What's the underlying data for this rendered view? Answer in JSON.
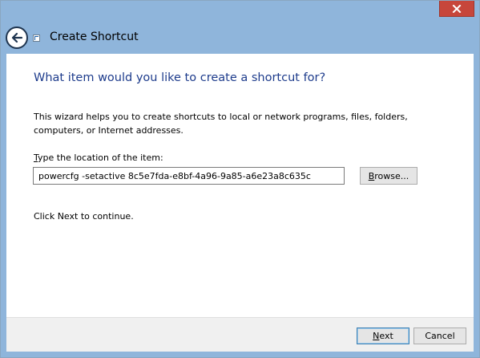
{
  "window": {
    "title": "Create Shortcut"
  },
  "content": {
    "heading": "What item would you like to create a shortcut for?",
    "description": "This wizard helps you to create shortcuts to local or network programs, files, folders, computers, or Internet addresses.",
    "field_label_prefix": "T",
    "field_label_rest": "ype the location of the item:",
    "location_value": "powercfg -setactive 8c5e7fda-e8bf-4a96-9a85-a6e23a8c635c",
    "browse_label_prefix": "B",
    "browse_label_rest": "rowse...",
    "continue_text": "Click Next to continue."
  },
  "footer": {
    "next_label_prefix": "N",
    "next_label_rest": "ext",
    "cancel_label": "Cancel"
  },
  "icons": {
    "back": "back-arrow-icon",
    "app": "shortcut-icon",
    "close": "close-icon"
  },
  "colors": {
    "frame": "#8fb5db",
    "heading": "#1e3c8c",
    "close": "#c7463b"
  }
}
